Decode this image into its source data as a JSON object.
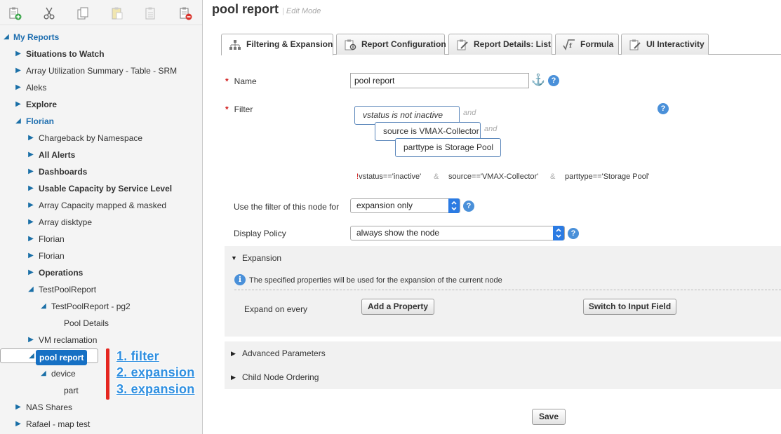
{
  "toolbar": {
    "icons": [
      "add-report-icon",
      "cut-icon",
      "copy-icon",
      "paste-icon",
      "paste-special-icon",
      "delete-report-icon"
    ]
  },
  "tree": {
    "root_label": "My Reports",
    "items": [
      {
        "label": "Situations to Watch"
      },
      {
        "label": "Array Utilization Summary - Table - SRM"
      },
      {
        "label": "Aleks"
      },
      {
        "label": "Explore"
      },
      {
        "label": "Florian"
      },
      {
        "label": "Chargeback by Namespace"
      },
      {
        "label": "All Alerts"
      },
      {
        "label": "Dashboards"
      },
      {
        "label": "Usable Capacity by Service Level"
      },
      {
        "label": "Array Capacity mapped & masked"
      },
      {
        "label": "Array disktype"
      },
      {
        "label": "Florian"
      },
      {
        "label": "Florian"
      },
      {
        "label": "Operations"
      },
      {
        "label": "TestPoolReport"
      },
      {
        "label": "TestPoolReport - pg2"
      },
      {
        "label": "Pool Details"
      },
      {
        "label": "VM reclamation"
      },
      {
        "label": "pool report"
      },
      {
        "label": "device"
      },
      {
        "label": "part"
      },
      {
        "label": "NAS Shares"
      },
      {
        "label": "Rafael - map test"
      }
    ]
  },
  "annotations": [
    "1. filter",
    "2. expansion",
    "3. expansion"
  ],
  "page": {
    "title": "pool report",
    "mode": "Edit Mode"
  },
  "tabs": [
    {
      "label": "Filtering & Expansion",
      "icon": "hierarchy-icon",
      "active": true
    },
    {
      "label": "Report Configuration",
      "icon": "report-config-icon"
    },
    {
      "label": "Report Details: List",
      "icon": "report-details-icon"
    },
    {
      "label": "Formula",
      "icon": "formula-icon"
    },
    {
      "label": "UI Interactivity",
      "icon": "ui-interactivity-icon"
    }
  ],
  "form": {
    "name_label": "Name",
    "name_value": "pool report",
    "filter_label": "Filter",
    "filter_conditions": [
      "vstatus is not inactive",
      "source is VMAX-Collector",
      "parttype is Storage Pool"
    ],
    "and_word": "and",
    "expression": {
      "bang": "!",
      "parts": [
        "vstatus=='inactive'",
        "source=='VMAX-Collector'",
        "parttype=='Storage Pool'"
      ],
      "amp": "&"
    },
    "use_filter_label": "Use the filter of this node for",
    "use_filter_value": "expansion only",
    "display_policy_label": "Display Policy",
    "display_policy_value": "always show the node"
  },
  "expansion": {
    "title": "Expansion",
    "info": "The specified properties will be used for the expansion of the current node",
    "expand_label": "Expand on every",
    "add_property": "Add a Property",
    "switch_input": "Switch to Input Field"
  },
  "sections": {
    "advanced": "Advanced Parameters",
    "child_ordering": "Child Node Ordering"
  },
  "save_label": "Save",
  "colors": {
    "accent": "#1670c4",
    "annotation_text": "#2f8fe0",
    "annotation_bar": "#e52620",
    "required": "#d21f1f"
  }
}
